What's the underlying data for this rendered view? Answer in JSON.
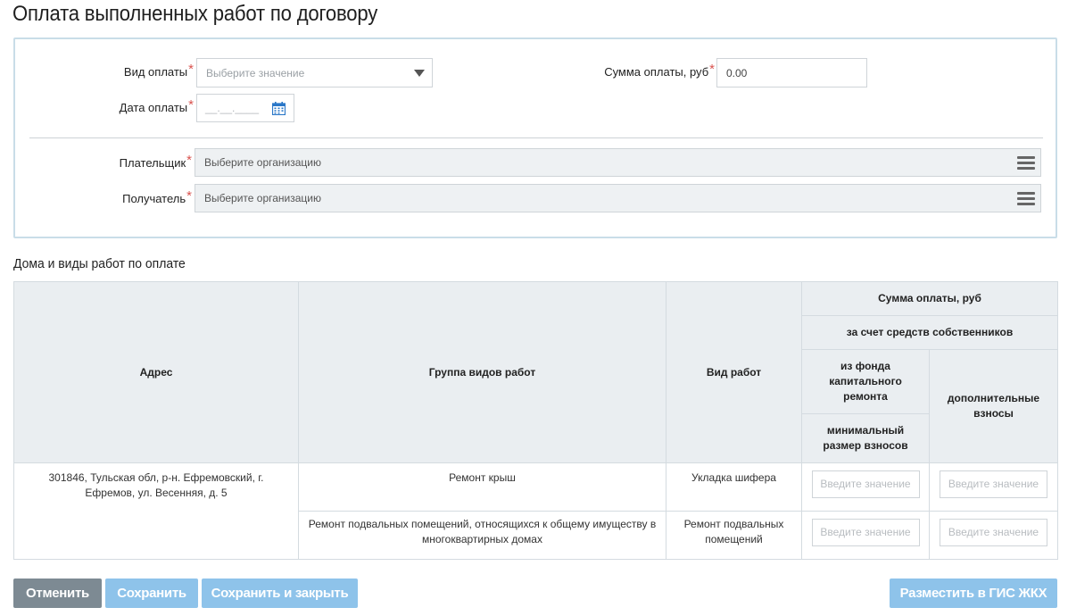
{
  "page": {
    "title": "Оплата выполненных работ по договору"
  },
  "form": {
    "payment_type": {
      "label": "Вид оплаты",
      "placeholder": "Выберите значение"
    },
    "payment_amount": {
      "label": "Сумма оплаты, руб",
      "value": "0.00"
    },
    "payment_date": {
      "label": "Дата оплаты",
      "mask": "__.__.____"
    },
    "payer": {
      "label": "Плательщик",
      "placeholder": "Выберите организацию"
    },
    "recipient": {
      "label": "Получатель",
      "placeholder": "Выберите организацию"
    },
    "required_mark": "*"
  },
  "houses": {
    "title": "Дома и виды работ по оплате",
    "headers": {
      "address": "Адрес",
      "work_group": "Группа видов работ",
      "work_type": "Вид работ",
      "payment_sum": "Сумма оплаты, руб",
      "owners_funds": "за счет средств собственников",
      "capital_fund": "из фонда капитального ремонта",
      "min_contrib": "минимальный размер взносов",
      "additional": "дополнительные взносы"
    },
    "rows": [
      {
        "address": "301846, Тульская обл, р-н. Ефремовский, г. Ефремов, ул. Весенняя, д. 5",
        "work_group": "Ремонт крыш",
        "work_type": "Укладка шифера",
        "min_placeholder": "Введите значение",
        "add_placeholder": "Введите значение"
      },
      {
        "work_group": "Ремонт подвальных помещений, относящихся к общему имуществу в многоквартирных домах",
        "work_type": "Ремонт подвальных помещений",
        "min_placeholder": "Введите значение",
        "add_placeholder": "Введите значение"
      }
    ]
  },
  "actions": {
    "cancel": "Отменить",
    "save": "Сохранить",
    "save_close": "Сохранить и закрыть",
    "publish": "Разместить в ГИС ЖКХ"
  },
  "colors": {
    "accent_blue": "#8ec3ea",
    "cancel_gray": "#7d8a93",
    "required": "#d9534f",
    "calendar_icon": "#2a77c8"
  },
  "icons": {
    "payment_type_dropdown": "chevron-down-icon",
    "date_picker": "calendar-icon",
    "payer_picker": "menu-icon",
    "recipient_picker": "menu-icon"
  }
}
